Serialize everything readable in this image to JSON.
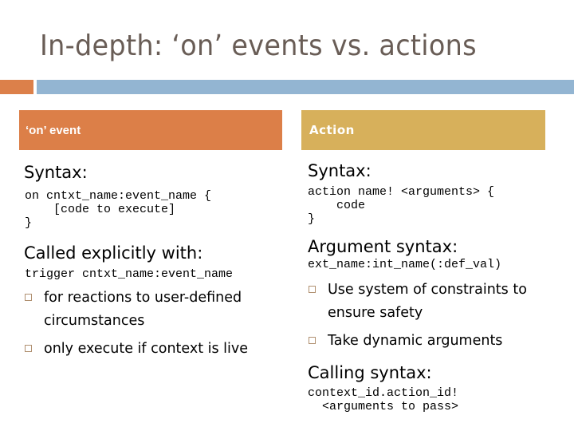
{
  "title": "In-depth: ‘on’ events vs. actions",
  "colors": {
    "title_text": "#695d56",
    "accent_orange": "#dc804a",
    "accent_blue": "#93b5d2",
    "left_header_bg": "#dc7f48",
    "right_header_bg": "#d7b05b",
    "bullet_outline": "#b09070"
  },
  "left": {
    "header": "‘on’ event",
    "syntax_heading": "Syntax:",
    "syntax_code": "on cntxt_name:event_name {\n    [code to execute]\n}",
    "called_heading": "Called explicitly with:",
    "called_code": "trigger cntxt_name:event_name",
    "bullets": [
      {
        "icon": "square-bullet-icon",
        "text": "for reactions to user-defined circumstances"
      },
      {
        "icon": "square-bullet-icon",
        "text": "only execute if context is live"
      }
    ]
  },
  "right": {
    "header": "Action",
    "syntax_heading": "Syntax:",
    "syntax_code": "action name! <arguments> {\n    code\n}",
    "arg_heading": "Argument syntax:",
    "arg_code": "ext_name:int_name(:def_val)",
    "bullets": [
      {
        "icon": "square-bullet-icon",
        "text": "Use system of constraints to ensure safety"
      },
      {
        "icon": "square-bullet-icon",
        "text": "Take dynamic arguments"
      }
    ],
    "calling_heading": "Calling syntax:",
    "calling_code": "context_id.action_id!\n  <arguments to pass>"
  }
}
